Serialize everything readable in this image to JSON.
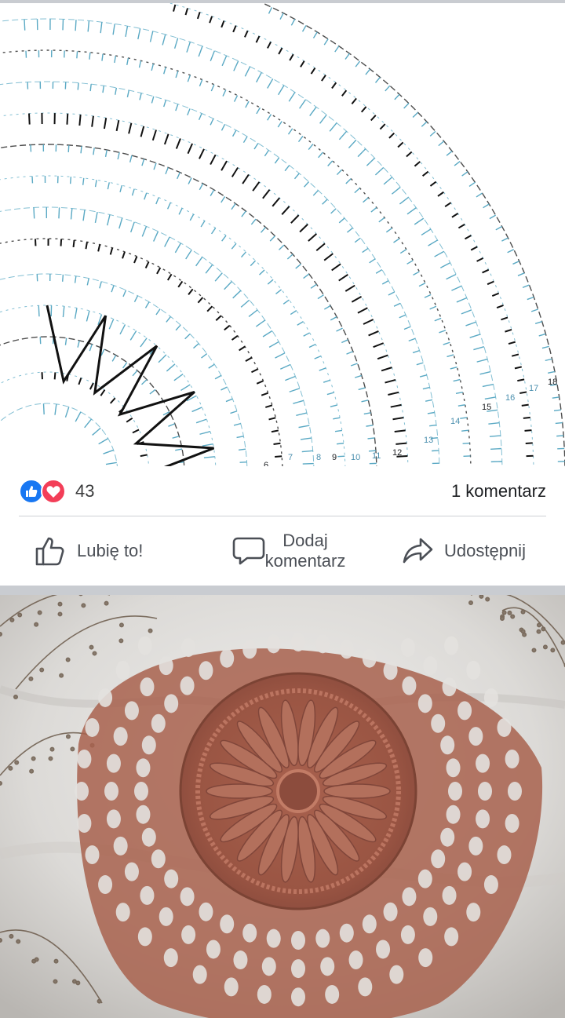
{
  "post": {
    "reactions": {
      "count": "43",
      "icons": [
        "like-icon",
        "love-icon"
      ]
    },
    "comments_label": "1 komentarz",
    "actions": {
      "like_label": "Lubię to!",
      "comment_label_line1": "Dodaj",
      "comment_label_line2": "komentarz",
      "share_label": "Udostępnij"
    },
    "diagram_row_numbers": [
      "6",
      "7",
      "8",
      "9",
      "10",
      "11",
      "12",
      "13",
      "14",
      "15",
      "16",
      "17",
      "18"
    ]
  },
  "colors": {
    "facebook_blue": "#1877f2",
    "love_red": "#f33e58",
    "diagram_blue": "#5aa9c4",
    "diagram_black": "#111111",
    "yarn_terracotta": "#a8614e"
  }
}
